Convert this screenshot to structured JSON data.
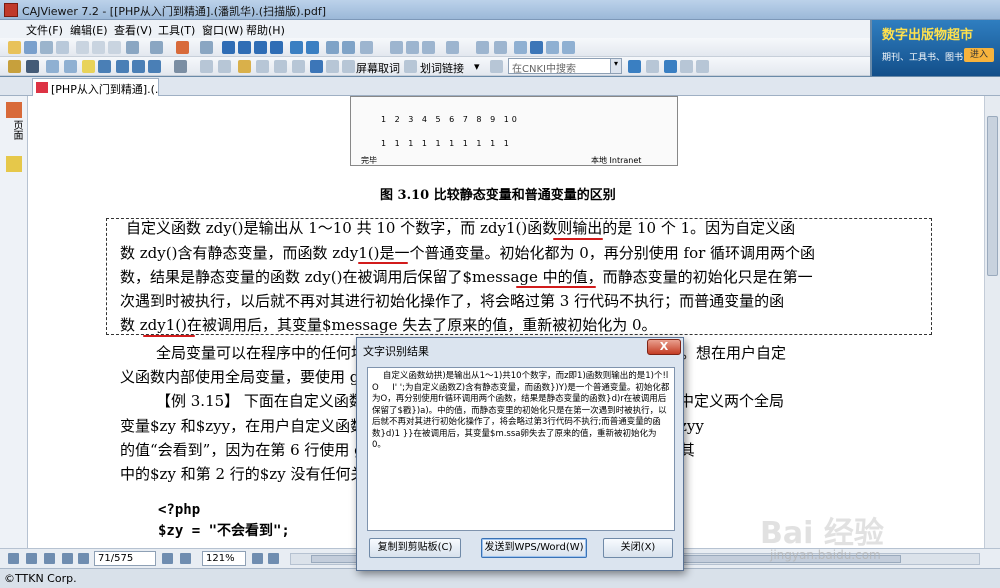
{
  "window": {
    "title": "CAJViewer 7.2 - [[PHP从入门到精通].(潘凯华).(扫描版).pdf]"
  },
  "menu": [
    "文件(F)",
    "编辑(E)",
    "查看(V)",
    "工具(T)",
    "窗口(W)",
    "帮助(H)"
  ],
  "toolbar": {
    "screen_ocr": "屏幕取词",
    "link_word": "划词链接",
    "search_placeholder": "在CNKI中搜索"
  },
  "banner": {
    "title": "数字出版物超市",
    "subtitle": "期刊、工具书、图书...",
    "enter": "进入"
  },
  "tab": {
    "label": "[PHP从入门到精通].(..."
  },
  "sidebar": {
    "label": "页面"
  },
  "document": {
    "figure_row1": "1 2 3 4 5 6 7 8 9 10",
    "figure_row2": "1 1 1 1 1 1 1 1 1 1",
    "figure_status_left": "完毕",
    "figure_status_right": "本地 Intranet",
    "figure_caption": "图 3.10    比较静态变量和普通变量的区别",
    "para1": [
      "自定义函数 zdy()是输出从 1～10 共 10 个数字，而 zdy1()函数则输出的是 10 个 1。因为自定义函",
      "数 zdy()含有静态变量，而函数 zdy1()是一个普通变量。初始化都为 0，再分别使用 for 循环调用两个函",
      "数，结果是静态变量的函数 zdy()在被调用后保留了$message 中的值，而静态变量的初始化只是在第一",
      "次遇到时被执行，以后就不再对其进行初始化操作了，将会略过第 3 行代码不执行；而普通变量的函",
      "数 zdy1()在被调用后，其变量$message 失去了原来的值，重新被初始化为 0。"
    ],
    "para2": [
      "全局变量可以在程序中的任何地方访问，但是在用户自定义函数内部是不可用的。想在用户自定",
      "义函数内部使用全局变量，要使用 global 关键字声明。",
      "【例 3.15】 下面在自定义函数中输出局部变量和全局变量的值进行对比。本例中定义两个全局",
      "变量$zy 和$zyy，在用户自定义函数中调用全局变量$zyy。而程序输出的结果只有$zyy",
      "的值“会看到”，因为在第 6 行使用 global 定义了变量，而第 5 行不会有任何输出，其",
      "中的$zy 和第 2 行的$zy 没有任何关系。（实例位置：光盘\\TM\\sl\\3\\15）"
    ],
    "code1": "<?php",
    "code2": "$zy = \"不会看到\";"
  },
  "nav": {
    "page": "71/575",
    "zoom": "121%"
  },
  "status": {
    "copyright": "©TTKN Corp."
  },
  "dialog": {
    "title": "文字识别结果",
    "close": "X",
    "text": "    自定义函数幼拱)是输出从1～1)共10个数字，而z即1)函数则输出的是1)个!l  O     I' ';为自定义函数Z)含有静态变量，而函数})Y)是一个普通变量。初始化都为O，再分别使用fr循环调用两个函数，结果是静态变量的函数}d)r在被调用后保留了$戳})a)。中的值，而静态变里的初始化只是在第一次遇到时被执行，以后就不再对其进行初始化操作了，将会略过第3行代码不执行;而普通变量的函数}d)1 }}在被调用后，其变量$m.ssa卵失去了原来的值，重新被初始化为0。",
    "btn_copy": "复制到剪贴板(C)",
    "btn_send": "发送到WPS/Word(W)",
    "btn_close": "关闭(X)"
  },
  "watermark": {
    "main": "Bai 经验",
    "url": "jingyan.baidu.com"
  }
}
